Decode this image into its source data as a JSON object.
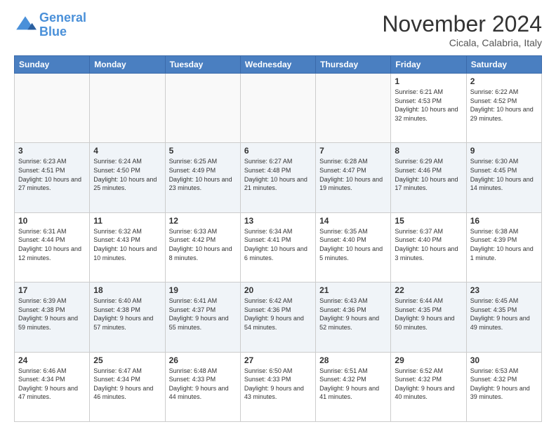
{
  "logo": {
    "text_general": "General",
    "text_blue": "Blue"
  },
  "title": "November 2024",
  "location": "Cicala, Calabria, Italy",
  "days_of_week": [
    "Sunday",
    "Monday",
    "Tuesday",
    "Wednesday",
    "Thursday",
    "Friday",
    "Saturday"
  ],
  "weeks": [
    [
      {
        "day": "",
        "info": ""
      },
      {
        "day": "",
        "info": ""
      },
      {
        "day": "",
        "info": ""
      },
      {
        "day": "",
        "info": ""
      },
      {
        "day": "",
        "info": ""
      },
      {
        "day": "1",
        "info": "Sunrise: 6:21 AM\nSunset: 4:53 PM\nDaylight: 10 hours and 32 minutes."
      },
      {
        "day": "2",
        "info": "Sunrise: 6:22 AM\nSunset: 4:52 PM\nDaylight: 10 hours and 29 minutes."
      }
    ],
    [
      {
        "day": "3",
        "info": "Sunrise: 6:23 AM\nSunset: 4:51 PM\nDaylight: 10 hours and 27 minutes."
      },
      {
        "day": "4",
        "info": "Sunrise: 6:24 AM\nSunset: 4:50 PM\nDaylight: 10 hours and 25 minutes."
      },
      {
        "day": "5",
        "info": "Sunrise: 6:25 AM\nSunset: 4:49 PM\nDaylight: 10 hours and 23 minutes."
      },
      {
        "day": "6",
        "info": "Sunrise: 6:27 AM\nSunset: 4:48 PM\nDaylight: 10 hours and 21 minutes."
      },
      {
        "day": "7",
        "info": "Sunrise: 6:28 AM\nSunset: 4:47 PM\nDaylight: 10 hours and 19 minutes."
      },
      {
        "day": "8",
        "info": "Sunrise: 6:29 AM\nSunset: 4:46 PM\nDaylight: 10 hours and 17 minutes."
      },
      {
        "day": "9",
        "info": "Sunrise: 6:30 AM\nSunset: 4:45 PM\nDaylight: 10 hours and 14 minutes."
      }
    ],
    [
      {
        "day": "10",
        "info": "Sunrise: 6:31 AM\nSunset: 4:44 PM\nDaylight: 10 hours and 12 minutes."
      },
      {
        "day": "11",
        "info": "Sunrise: 6:32 AM\nSunset: 4:43 PM\nDaylight: 10 hours and 10 minutes."
      },
      {
        "day": "12",
        "info": "Sunrise: 6:33 AM\nSunset: 4:42 PM\nDaylight: 10 hours and 8 minutes."
      },
      {
        "day": "13",
        "info": "Sunrise: 6:34 AM\nSunset: 4:41 PM\nDaylight: 10 hours and 6 minutes."
      },
      {
        "day": "14",
        "info": "Sunrise: 6:35 AM\nSunset: 4:40 PM\nDaylight: 10 hours and 5 minutes."
      },
      {
        "day": "15",
        "info": "Sunrise: 6:37 AM\nSunset: 4:40 PM\nDaylight: 10 hours and 3 minutes."
      },
      {
        "day": "16",
        "info": "Sunrise: 6:38 AM\nSunset: 4:39 PM\nDaylight: 10 hours and 1 minute."
      }
    ],
    [
      {
        "day": "17",
        "info": "Sunrise: 6:39 AM\nSunset: 4:38 PM\nDaylight: 9 hours and 59 minutes."
      },
      {
        "day": "18",
        "info": "Sunrise: 6:40 AM\nSunset: 4:38 PM\nDaylight: 9 hours and 57 minutes."
      },
      {
        "day": "19",
        "info": "Sunrise: 6:41 AM\nSunset: 4:37 PM\nDaylight: 9 hours and 55 minutes."
      },
      {
        "day": "20",
        "info": "Sunrise: 6:42 AM\nSunset: 4:36 PM\nDaylight: 9 hours and 54 minutes."
      },
      {
        "day": "21",
        "info": "Sunrise: 6:43 AM\nSunset: 4:36 PM\nDaylight: 9 hours and 52 minutes."
      },
      {
        "day": "22",
        "info": "Sunrise: 6:44 AM\nSunset: 4:35 PM\nDaylight: 9 hours and 50 minutes."
      },
      {
        "day": "23",
        "info": "Sunrise: 6:45 AM\nSunset: 4:35 PM\nDaylight: 9 hours and 49 minutes."
      }
    ],
    [
      {
        "day": "24",
        "info": "Sunrise: 6:46 AM\nSunset: 4:34 PM\nDaylight: 9 hours and 47 minutes."
      },
      {
        "day": "25",
        "info": "Sunrise: 6:47 AM\nSunset: 4:34 PM\nDaylight: 9 hours and 46 minutes."
      },
      {
        "day": "26",
        "info": "Sunrise: 6:48 AM\nSunset: 4:33 PM\nDaylight: 9 hours and 44 minutes."
      },
      {
        "day": "27",
        "info": "Sunrise: 6:50 AM\nSunset: 4:33 PM\nDaylight: 9 hours and 43 minutes."
      },
      {
        "day": "28",
        "info": "Sunrise: 6:51 AM\nSunset: 4:32 PM\nDaylight: 9 hours and 41 minutes."
      },
      {
        "day": "29",
        "info": "Sunrise: 6:52 AM\nSunset: 4:32 PM\nDaylight: 9 hours and 40 minutes."
      },
      {
        "day": "30",
        "info": "Sunrise: 6:53 AM\nSunset: 4:32 PM\nDaylight: 9 hours and 39 minutes."
      }
    ]
  ]
}
